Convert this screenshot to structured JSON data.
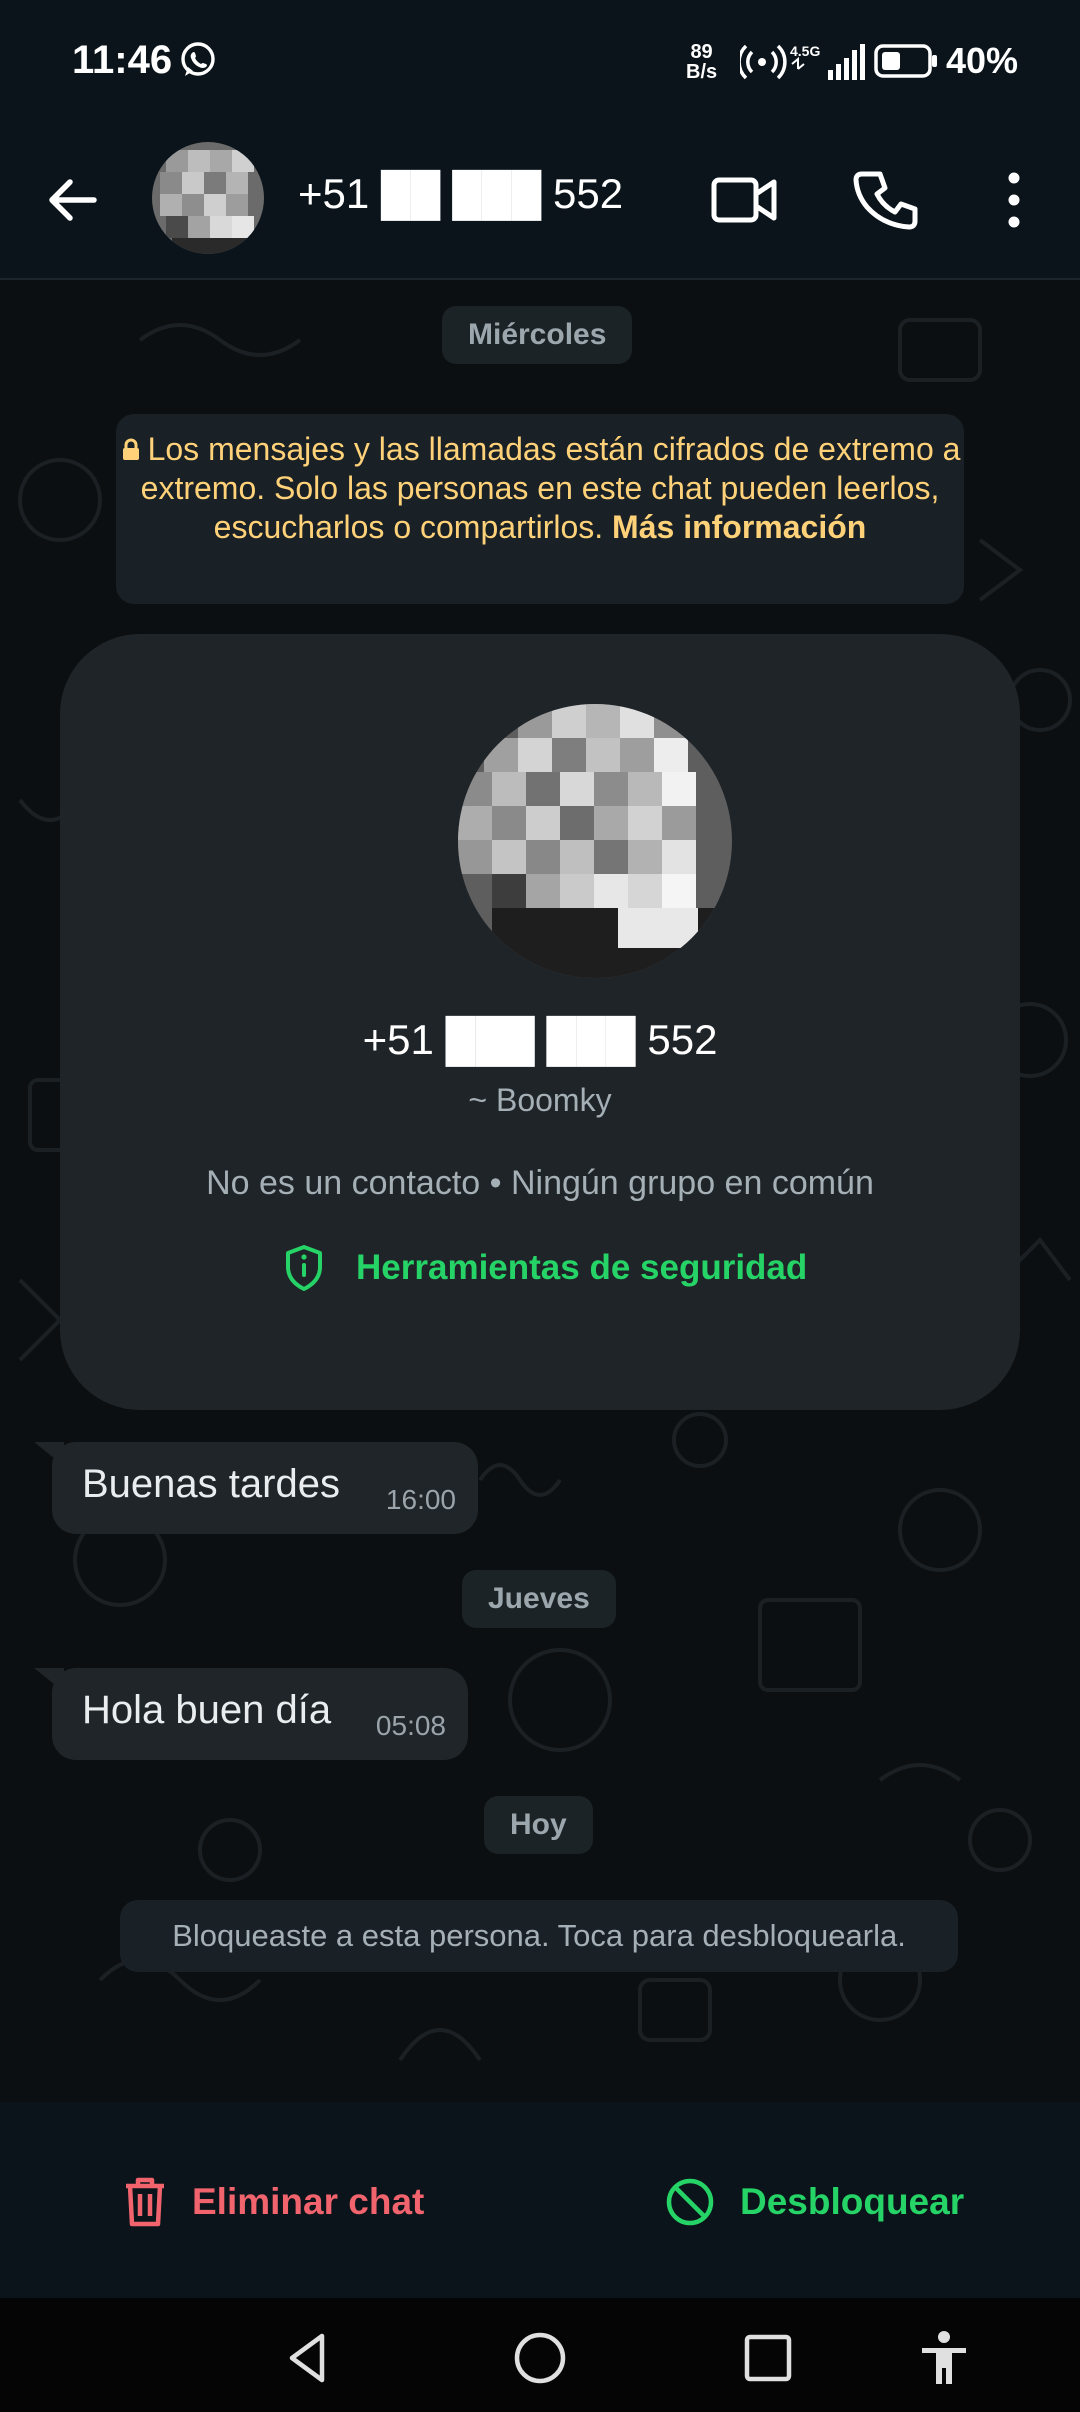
{
  "status_bar": {
    "time": "11:46",
    "net_speed_value": "89",
    "net_speed_unit": "B/s",
    "battery_pct": "40%",
    "icons": [
      "whatsapp-icon",
      "hotspot-icon",
      "signal-4.5g-icon",
      "battery-icon"
    ]
  },
  "header": {
    "title": "+51 ██ ███ 552",
    "actions": [
      "back-arrow-icon",
      "video-call-icon",
      "phone-icon",
      "more-vert-icon"
    ]
  },
  "chat": {
    "date_1": "Miércoles",
    "encryption_note": "Los mensajes y las llamadas están cifrados de extremo a extremo. Solo las personas en este chat pueden leerlos, escucharlos o compartirlos.",
    "encryption_link": "Más información",
    "contact_card": {
      "phone": "+51 ███ ███ 552",
      "name": "~ Boomky",
      "meta": "No es un contacto • Ningún grupo en común",
      "tools_label": "Herramientas de seguridad"
    },
    "messages": [
      {
        "text": "Buenas tardes",
        "time": "16:00"
      },
      {
        "text": "Hola buen día",
        "time": "05:08"
      }
    ],
    "date_2": "Jueves",
    "date_3": "Hoy",
    "blocked_note": "Bloqueaste a esta persona. Toca para desbloquearla."
  },
  "actions": {
    "delete_label": "Eliminar chat",
    "unblock_label": "Desbloquear"
  },
  "colors": {
    "accent_green": "#25d366",
    "danger_red": "#f1636d",
    "encryption_yellow": "#ffd279",
    "bubble": "#1f2528",
    "header_bg": "#0b141a"
  },
  "nav": [
    "back-triangle-icon",
    "home-circle-icon",
    "recents-square-icon",
    "accessibility-icon"
  ]
}
